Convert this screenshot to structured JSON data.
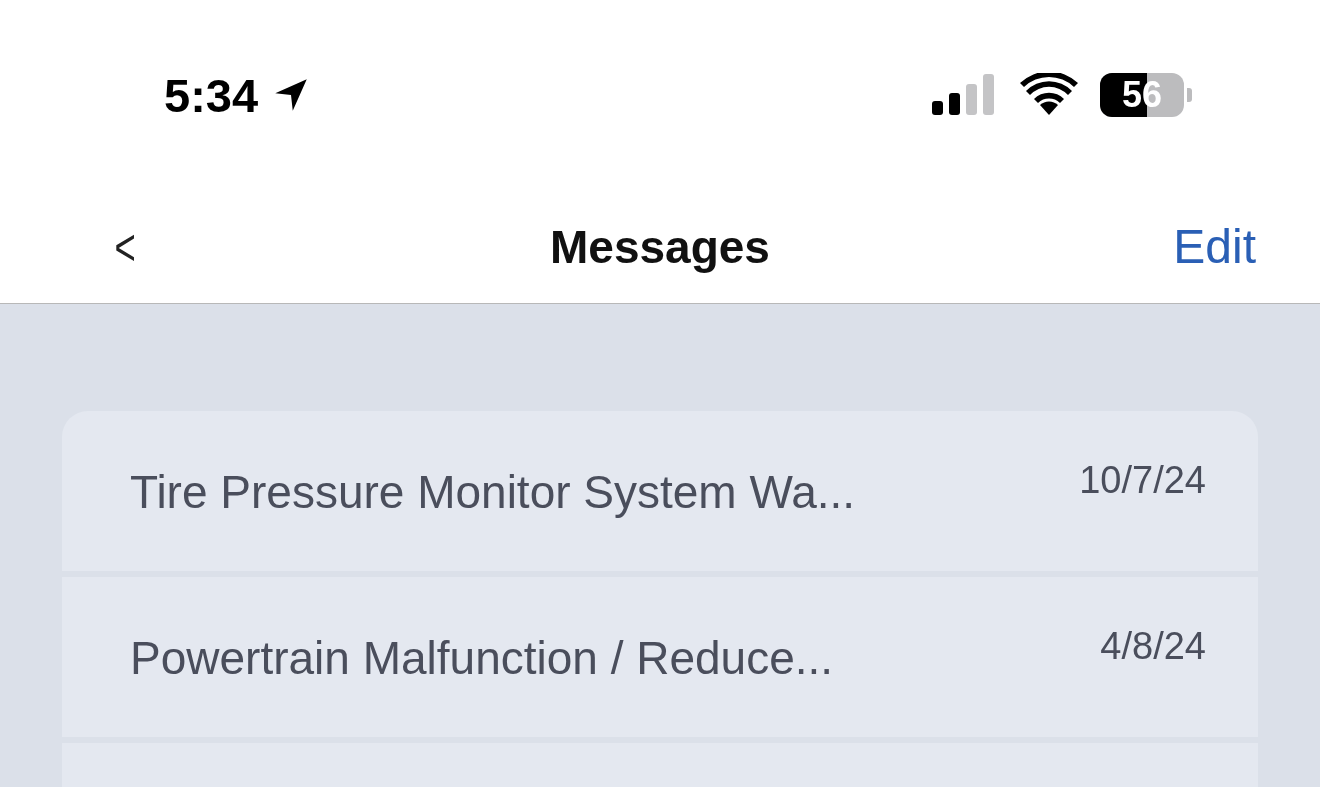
{
  "status_bar": {
    "time": "5:34",
    "battery": "56"
  },
  "nav": {
    "back": "<",
    "title": "Messages",
    "action": "Edit"
  },
  "messages": [
    {
      "title": "Tire Pressure Monitor System Wa...",
      "date": "10/7/24"
    },
    {
      "title": "Powertrain Malfunction / Reduce...",
      "date": "4/8/24"
    }
  ]
}
